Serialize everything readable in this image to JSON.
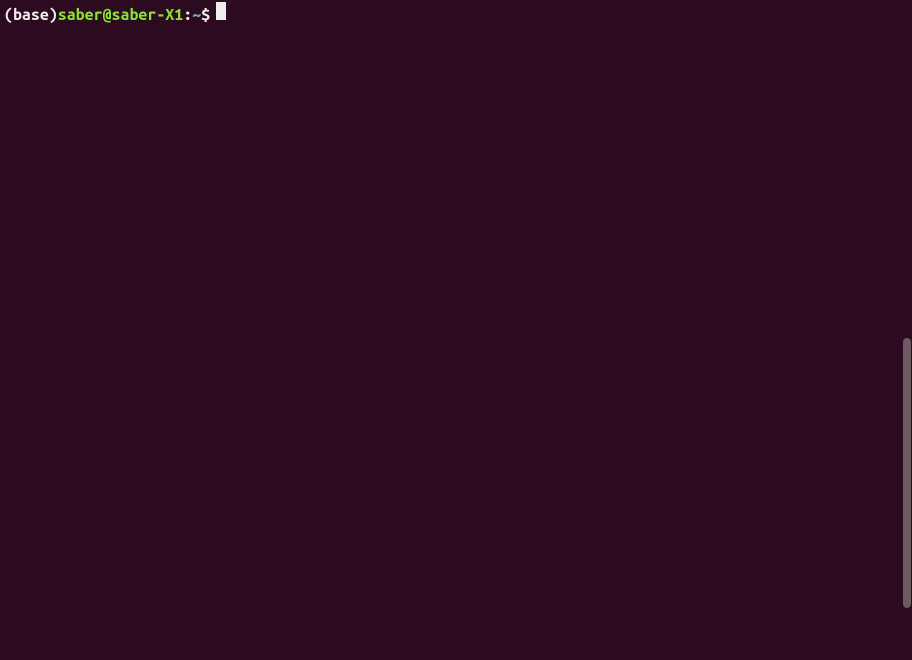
{
  "terminal": {
    "prompt": {
      "env_prefix": "(base) ",
      "user_host": "saber@saber-X1",
      "colon": ":",
      "path": "~",
      "dollar": "$"
    },
    "command": ""
  },
  "colors": {
    "background": "#2c0a1f",
    "foreground": "#eeeeec",
    "user_green": "#8ae234",
    "path_blue": "#729fcf",
    "scrollbar_thumb": "#6e5a63"
  }
}
